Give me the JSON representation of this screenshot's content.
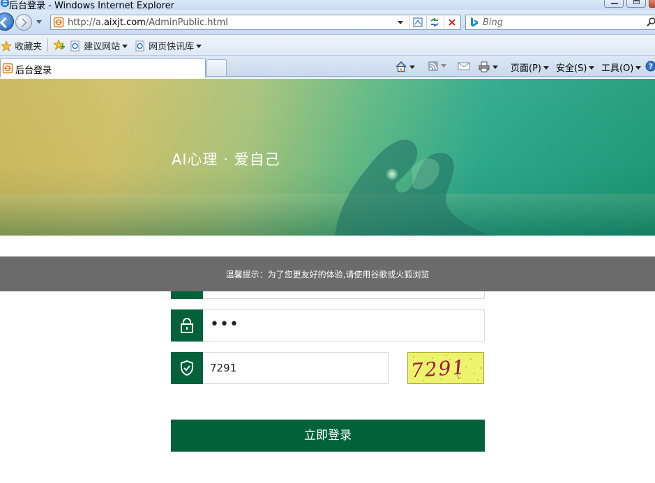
{
  "browser": {
    "window_title": "后台登录 - Windows Internet Explorer",
    "address": {
      "prefix": "http://a.",
      "domain": "aixjt.com",
      "path": "/AdminPublic.html"
    },
    "search_placeholder": "Bing",
    "favorites": {
      "favorites_label": "收藏夹",
      "suggested_sites": "建议网站",
      "web_slices": "网页快讯库"
    },
    "tab_title": "后台登录",
    "commands": {
      "page": "页面(P)",
      "safety": "安全(S)",
      "tools": "工具(O)"
    }
  },
  "page": {
    "slogan": "AI心理 · 爱自己",
    "notice": "温馨提示：为了您更友好的体验,请使用谷歌或火狐浏览",
    "username_value": "",
    "password_value": "•••",
    "captcha_value": "7291",
    "captcha_image_text": "7291",
    "login_button": "立即登录"
  },
  "colors": {
    "brand_green": "#03623a",
    "notice_bg": "#6b6b6b",
    "captcha_bg": "#eef36e",
    "captcha_text": "#9b1c3a"
  },
  "icons": [
    "ie-icon",
    "back-icon",
    "forward-icon",
    "page-icon",
    "compat-view-icon",
    "refresh-icon",
    "stop-icon",
    "bing-icon",
    "search-icon",
    "favorites-star-icon",
    "add-favorite-icon",
    "ie-page-icon",
    "home-icon",
    "feeds-icon",
    "mail-icon",
    "print-icon",
    "help-icon",
    "user-icon",
    "lock-icon",
    "shield-check-icon"
  ]
}
